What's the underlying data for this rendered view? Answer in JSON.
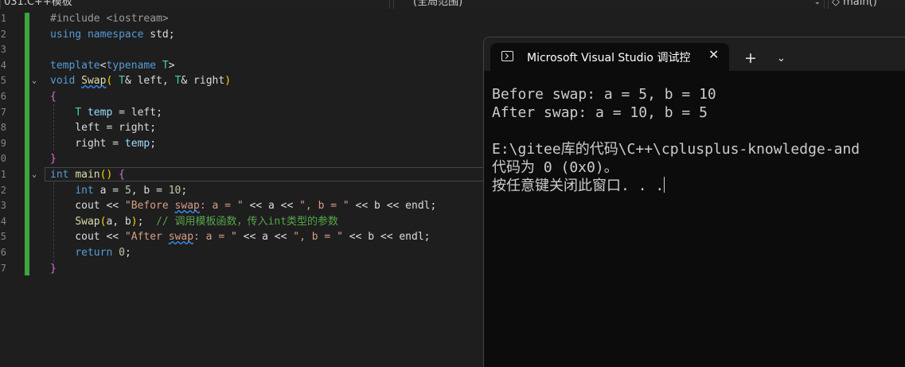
{
  "toolbar": {
    "project_dropdown": "031.C++模板",
    "scope_dropdown": "(全局范围)",
    "member_dropdown": "main()"
  },
  "editor": {
    "line_numbers": [
      "1",
      "2",
      "3",
      "4",
      "5",
      "6",
      "7",
      "8",
      "9",
      "0",
      "1",
      "2",
      "3",
      "4",
      "5",
      "6",
      "7"
    ],
    "lines": [
      "#include <iostream>",
      "using namespace std;",
      "",
      "template<typename T>",
      "void Swap( T& left, T& right)",
      "{",
      "    T temp = left;",
      "    left = right;",
      "    right = temp;",
      "}",
      "int main() {",
      "    int a = 5, b = 10;",
      "    cout << \"Before swap: a = \" << a << \", b = \" << b << endl;",
      "    Swap(a, b);  // 调用模板函数，传入int类型的参数",
      "    cout << \"After swap: a = \" << a << \", b = \" << b << endl;",
      "    return 0;",
      "}"
    ]
  },
  "console": {
    "tab_title": "Microsoft Visual Studio 调试控",
    "new_tab": "+",
    "output": [
      "Before swap: a = 5, b = 10",
      "After swap: a = 10, b = 5",
      "",
      "E:\\gitee库的代码\\C++\\cplusplus-knowledge-and",
      "代码为 0 (0x0)。",
      "按任意键关闭此窗口. . ."
    ]
  },
  "colors": {
    "editor_bg": "#1e1e1e",
    "console_bg": "#0c0c0c",
    "keyword": "#569cd6",
    "type": "#4ec9b0",
    "function": "#dcdcaa",
    "string": "#d69d85",
    "comment": "#57a64a",
    "change_bar": "#3fa33f"
  }
}
